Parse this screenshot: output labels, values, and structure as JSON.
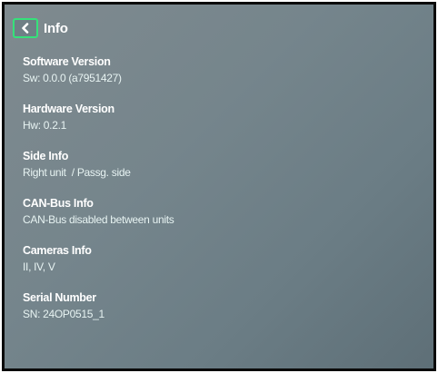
{
  "header": {
    "title": "Info",
    "back_icon": "chevron-left-icon",
    "accent_color": "#35e27a"
  },
  "sections": [
    {
      "label": "Software Version",
      "value": "Sw: 0.0.0 (a7951427)"
    },
    {
      "label": "Hardware Version",
      "value": "Hw: 0.2.1"
    },
    {
      "label": "Side Info",
      "value": "Right unit  / Passg. side"
    },
    {
      "label": "CAN-Bus Info",
      "value": "CAN-Bus disabled between units"
    },
    {
      "label": "Cameras Info",
      "value": "II, IV, V"
    },
    {
      "label": "Serial Number",
      "value": "SN: 24OP0515_1"
    }
  ]
}
